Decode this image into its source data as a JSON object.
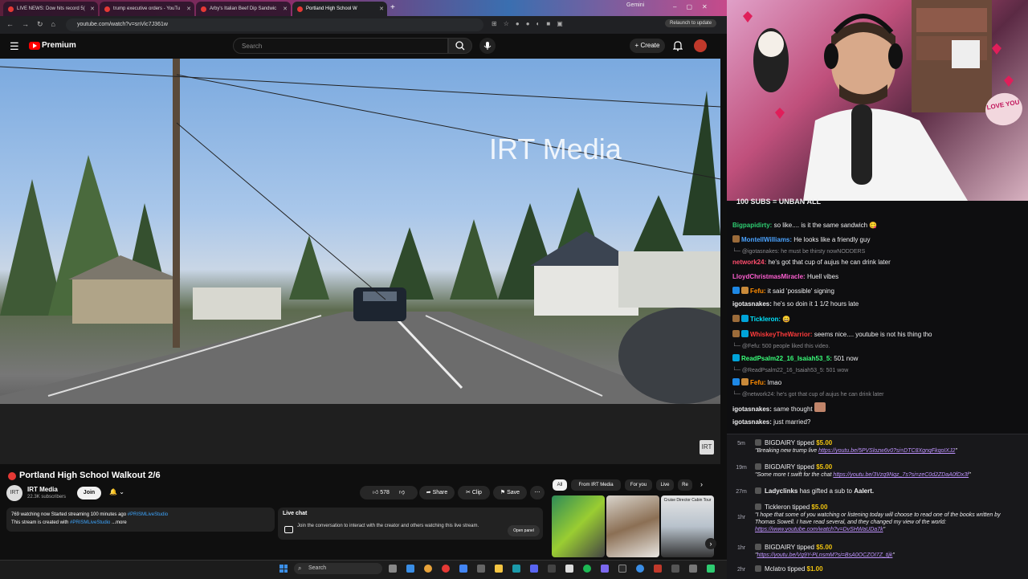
{
  "browser": {
    "tabs": [
      {
        "title": "LIVE NEWS: Dow hits record 5("
      },
      {
        "title": "trump executive orders - YouTu"
      },
      {
        "title": "Arby's Italian Beef Dip Sandwic"
      },
      {
        "title": "Portland High School W"
      }
    ],
    "gemini": "Gemini",
    "url": "youtube.com/watch?v=snVic7J361w",
    "relaunch": "Relaunch to update"
  },
  "youtube": {
    "brand": "Premium",
    "search_placeholder": "Search",
    "create_label": "Create",
    "video": {
      "watermark": "IRT Media",
      "title": "Portland High School Walkout 2/6"
    },
    "channel": {
      "name": "IRT Media",
      "subscribers": "22.3K subscribers",
      "avatar_text": "IRT",
      "join_label": "Join"
    },
    "actions": {
      "likes": "578",
      "share": "Share",
      "clip": "Clip",
      "save": "Save"
    },
    "description": {
      "line1": "769 watching now  Started streaming 100 minutes ago",
      "tag1": "#PRISMLiveStudio",
      "line2": "This stream is created with",
      "tag2": "#PRISMLiveStudio",
      "more": "...more"
    },
    "live_chat": {
      "title": "Live chat",
      "text": "Join the conversation to interact with the creator and others watching this live stream.",
      "open_panel": "Open panel"
    },
    "chips": [
      "All",
      "From IRT Media",
      "For you",
      "Live",
      "Re"
    ],
    "thumb_caption": "Cruise Director Cabin Tour"
  },
  "taskbar": {
    "search": "Search"
  },
  "stream": {
    "love_card": "LOVE YOU",
    "chat_banner": "100 SUBS = UNBAN ALL",
    "messages": [
      {
        "user": "Bigpapidirty:",
        "text": "so like.... is it the same sandwich 😋",
        "color": "#2ecc71"
      },
      {
        "user": "MontellWilliams:",
        "text": "He looks like a friendly guy",
        "color": "#4aa3ff"
      },
      {
        "reply": "@igotasnakes: he must be thirsty nowNODDERS"
      },
      {
        "user": "network24:",
        "text": "he's got that cup of aujus he can drink later",
        "color": "#ff4d6d"
      },
      {
        "user": "LloydChristmasMiracle:",
        "text": "Huell vibes",
        "color": "#ff5fd2"
      },
      {
        "user": "Fefu:",
        "text": "it said 'possible' signing",
        "color": "#ff8c00"
      },
      {
        "user": "igotasnakes:",
        "text": "he's so doin it 1 1/2 hours late",
        "color": "#efeff1"
      },
      {
        "user": "Tickleron:",
        "text": "😄",
        "color": "#00e5ff"
      },
      {
        "user": "WhiskeyTheWarrior:",
        "text": "seems nice.... youtube is not his thing tho",
        "color": "#ff3b3b"
      },
      {
        "reply": "@Fefu: 500 people liked this video."
      },
      {
        "user": "ReadPsalm22_16_Isaiah53_5:",
        "text": "501 now",
        "color": "#39ff7a"
      },
      {
        "reply": "@ReadPsalm22_16_Isaiah53_5: 501 wow"
      },
      {
        "user": "Fefu:",
        "text": "lmao",
        "color": "#ff8c00"
      },
      {
        "reply": "@network24: he's got that cup of aujus he can drink later"
      },
      {
        "user": "igotasnakes:",
        "text": "same thought",
        "color": "#efeff1"
      },
      {
        "user": "igotasnakes:",
        "text": "just married?",
        "color": "#efeff1"
      }
    ],
    "tips": [
      {
        "time": "5m",
        "user": "BIGDAIRY",
        "verb": "tipped",
        "amount": "$5.00",
        "body": "\"Breaking new trump live",
        "link": "https://youtu.be/5PVSlozw6v0?si=DTC8XgnqFkqoIXJ2",
        "end": "\""
      },
      {
        "time": "19m",
        "user": "BIGDAIRY",
        "verb": "tipped",
        "amount": "$5.00",
        "body": "\"Some more t swift for the chat",
        "link": "https://youtu.be/3Vzq9Nqz_7s?si=zeC0d2ZDaA0fDx3f",
        "end": "\""
      },
      {
        "time": "27m",
        "user": "Ladyclinks",
        "verb": "has gifted a sub to",
        "amount": "Aalert.",
        "body": "",
        "link": "",
        "end": ""
      },
      {
        "time": "1hr",
        "user": "Tickleron",
        "verb": "tipped",
        "amount": "$5.00",
        "body": "\"I hope that some of you watching or listening today will choose to read one of the books written by Thomas Sowell. I have read several, and they changed my view of the world:",
        "link": "https://www.youtube.com/watch?v=DvSHWaUDa7k",
        "end": "\""
      },
      {
        "time": "1hr",
        "user": "BIGDAIRY",
        "verb": "tipped",
        "amount": "$5.00",
        "body": "\"",
        "link": "https://youtu.be/Vg9Y-PLnsmM?si=BsA0OCZOI7Z_tjjk",
        "end": "\""
      },
      {
        "time": "2hr",
        "user": "Mclatro",
        "verb": "tipped",
        "amount": "$1.00",
        "body": "",
        "link": "",
        "end": ""
      }
    ]
  }
}
